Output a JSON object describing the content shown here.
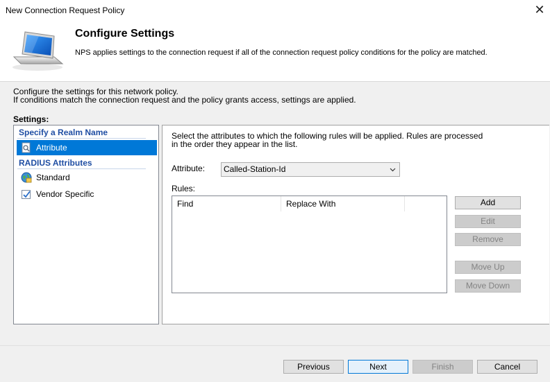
{
  "window": {
    "title": "New Connection Request Policy"
  },
  "header": {
    "title": "Configure Settings",
    "description": "NPS applies settings to the connection request if all of the connection request policy conditions for the policy are matched."
  },
  "intro": {
    "line1": "Configure the settings for this network policy.",
    "line2": "If conditions match the connection request and the policy grants access, settings are applied."
  },
  "settings_label": "Settings:",
  "nav": {
    "group1": "Specify a Realm Name",
    "attribute": "Attribute",
    "group2": "RADIUS Attributes",
    "standard": "Standard",
    "vendor_specific": "Vendor Specific"
  },
  "panel": {
    "description_line1": "Select the attributes to which the following rules will be applied. Rules are processed",
    "description_line2": "in the order they appear in the list.",
    "attribute_label": "Attribute:",
    "attribute_value": "Called-Station-Id",
    "rules_label": "Rules:",
    "columns": [
      "Find",
      "Replace With"
    ],
    "buttons": {
      "add": "Add",
      "edit": "Edit",
      "remove": "Remove",
      "move_up": "Move Up",
      "move_down": "Move Down"
    }
  },
  "footer": {
    "previous": "Previous",
    "next": "Next",
    "finish": "Finish",
    "cancel": "Cancel"
  },
  "icons": {
    "close": "close-icon",
    "header": "monitor-network-icon",
    "attribute": "attribute-icon",
    "standard": "globe-icon",
    "vendor_specific": "vendor-check-icon",
    "dropdown": "chevron-down-icon"
  },
  "colors": {
    "selection": "#0078d7",
    "group_heading": "#1f4ea3"
  }
}
